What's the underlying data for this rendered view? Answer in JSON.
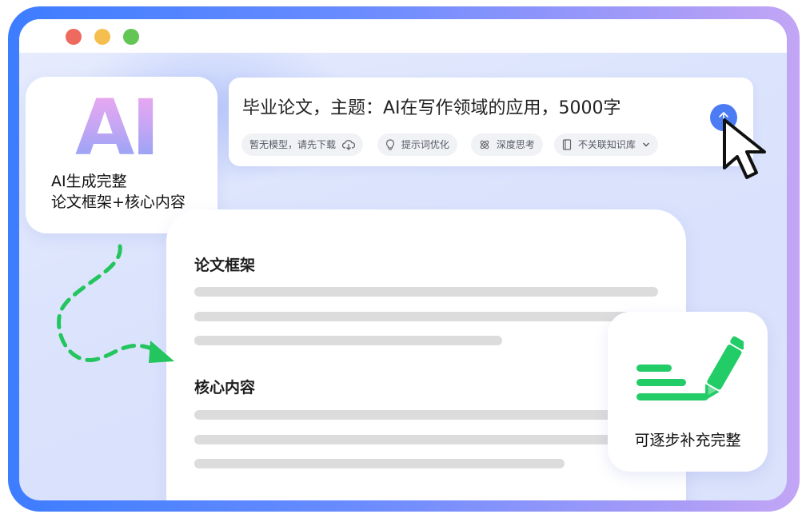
{
  "window": {
    "buttons": [
      "close",
      "minimize",
      "maximize"
    ]
  },
  "ai_card": {
    "logo": "AI",
    "line1": "AI生成完整",
    "line2": "论文框架+核心内容"
  },
  "prompt": {
    "text": "毕业论文，主题：AI在写作领域的应用，5000字",
    "send_icon": "arrow-up-icon",
    "chips": [
      {
        "label": "暂无模型，请先下载",
        "icon": "cloud-download-icon"
      },
      {
        "label": "提示词优化",
        "icon": "lightbulb-icon"
      },
      {
        "label": "深度思考",
        "icon": "atom-icon"
      },
      {
        "label": "不关联知识库",
        "icon": "book-icon"
      }
    ]
  },
  "document": {
    "section1_title": "论文框架",
    "section2_title": "核心内容"
  },
  "refine_card": {
    "text": "可逐步补充完整",
    "icon": "pencil-lines-icon"
  },
  "colors": {
    "accent_blue": "#4c7cf3",
    "green": "#22c55e",
    "frame_start": "#3d7dff",
    "frame_end": "#c3a6f5"
  }
}
